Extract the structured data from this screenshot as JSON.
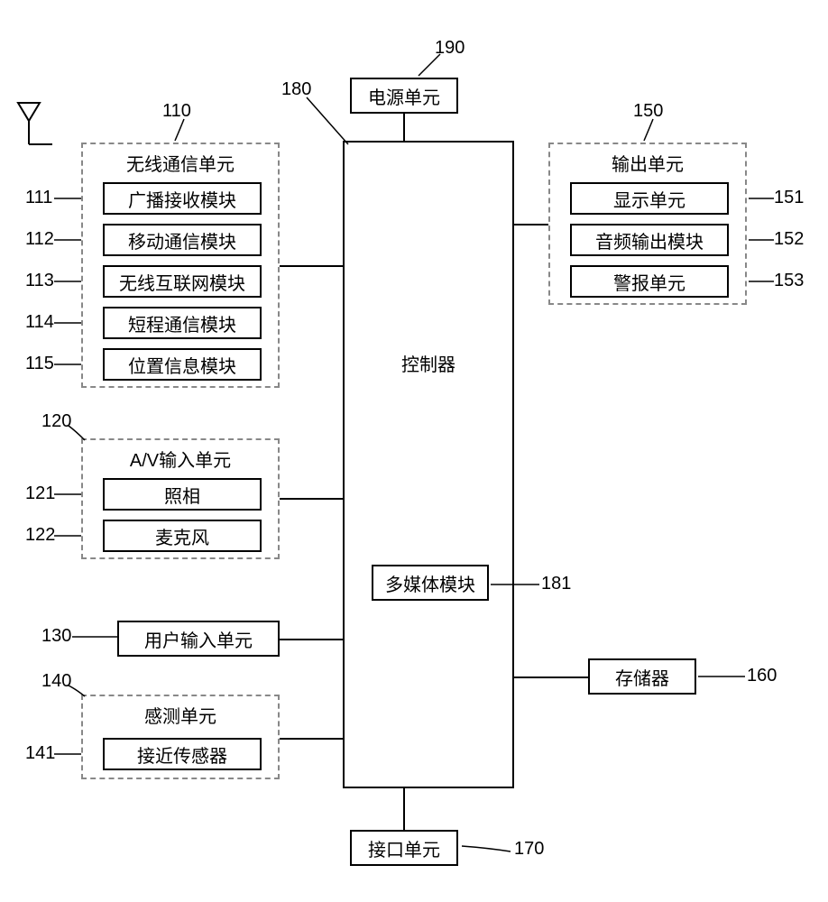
{
  "blocks": {
    "power": "电源单元",
    "controller": "控制器",
    "multimedia": "多媒体模块",
    "wireless_unit": "无线通信单元",
    "broadcast_rx": "广播接收模块",
    "mobile_comm": "移动通信模块",
    "wireless_net": "无线互联网模块",
    "short_range": "短程通信模块",
    "location_info": "位置信息模块",
    "av_unit": "A/V输入单元",
    "camera": "照相",
    "microphone": "麦克风",
    "user_input": "用户输入单元",
    "sensing_unit": "感测单元",
    "proximity": "接近传感器",
    "output_unit": "输出单元",
    "display": "显示单元",
    "audio_out": "音频输出模块",
    "alarm": "警报单元",
    "memory": "存储器",
    "interface": "接口单元"
  },
  "refs": {
    "r190": "190",
    "r180": "180",
    "r110": "110",
    "r111": "111",
    "r112": "112",
    "r113": "113",
    "r114": "114",
    "r115": "115",
    "r120": "120",
    "r121": "121",
    "r122": "122",
    "r130": "130",
    "r140": "140",
    "r141": "141",
    "r150": "150",
    "r151": "151",
    "r152": "152",
    "r153": "153",
    "r160": "160",
    "r170": "170",
    "r181": "181"
  }
}
